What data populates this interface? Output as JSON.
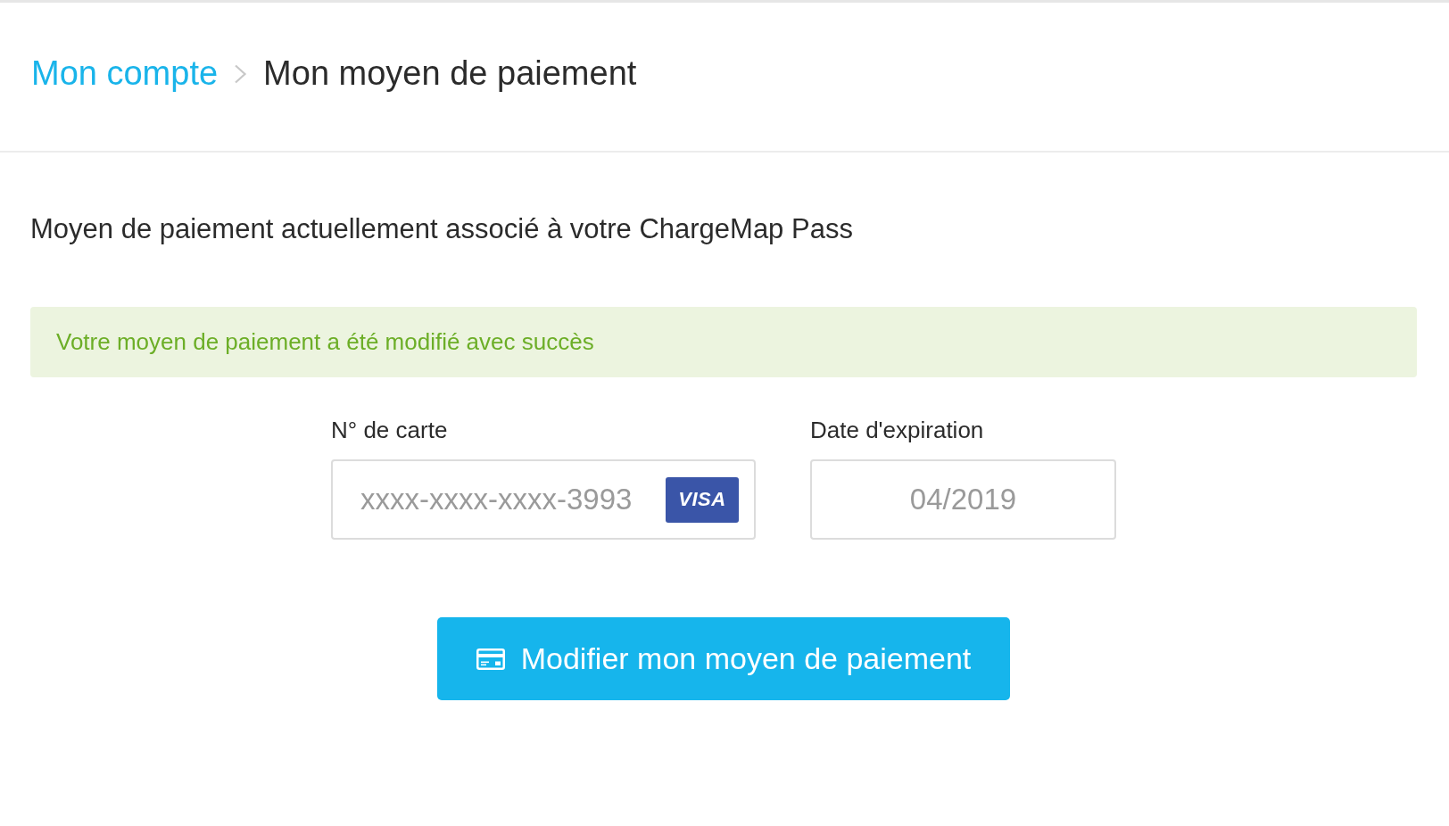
{
  "breadcrumb": [
    {
      "label": "Mon compte",
      "kind": "link"
    },
    {
      "label": "Mon moyen de paiement",
      "kind": "current"
    }
  ],
  "heading": "Moyen de paiement actuellement associé à votre ChargeMap Pass",
  "alert": {
    "kind": "success",
    "message": "Votre moyen de paiement a été modifié avec succès"
  },
  "fields": [
    {
      "kind": "card_number",
      "label": "N° de carte",
      "value": "xxxx-xxxx-xxxx-3993",
      "card_brand": "VISA"
    },
    {
      "kind": "expiry_date",
      "label": "Date d'expiration",
      "value": "04/2019"
    }
  ],
  "button": {
    "label": "Modifier mon moyen de paiement"
  }
}
